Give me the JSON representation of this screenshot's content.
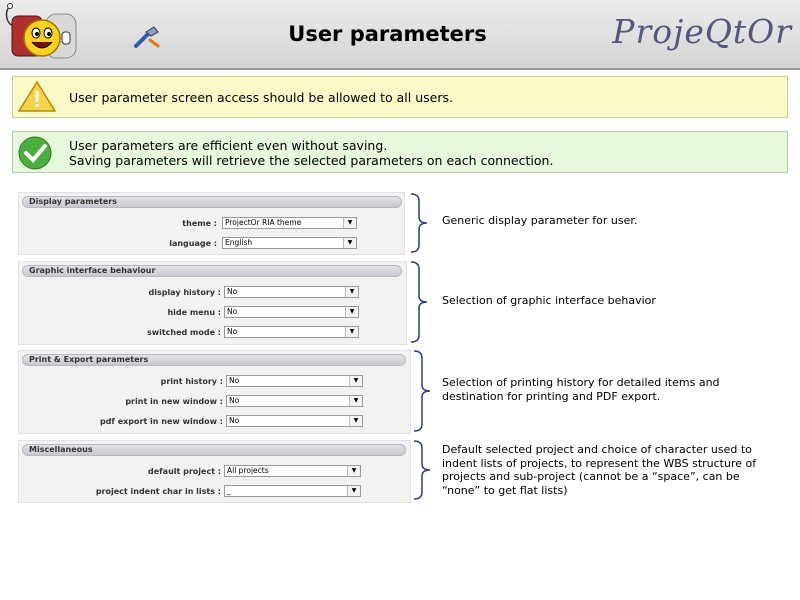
{
  "header": {
    "title": "User parameters",
    "brand": "ProjeQtOr",
    "icons": [
      "mascot-logo-icon",
      "tool-icon"
    ]
  },
  "notes": {
    "warning": "User parameter screen access should be allowed to all users.",
    "ok_line1": "User parameters are efficient even without saving.",
    "ok_line2": "Saving parameters will retrieve the selected parameters on each connection."
  },
  "panels": {
    "display": {
      "title": "Display parameters",
      "fields": [
        {
          "label": "theme :",
          "value": "ProjectOr RIA theme"
        },
        {
          "label": "language :",
          "value": "English"
        }
      ]
    },
    "graphic": {
      "title": "Graphic interface behaviour",
      "fields": [
        {
          "label": "display history :",
          "value": "No"
        },
        {
          "label": "hide menu :",
          "value": "No"
        },
        {
          "label": "switched mode :",
          "value": "No"
        }
      ]
    },
    "print": {
      "title": "Print & Export parameters",
      "fields": [
        {
          "label": "print history :",
          "value": "No"
        },
        {
          "label": "print in new window :",
          "value": "No"
        },
        {
          "label": "pdf export in new window :",
          "value": "No"
        }
      ]
    },
    "misc": {
      "title": "Miscellaneous",
      "fields": [
        {
          "label": "default project :",
          "value": "All projects"
        },
        {
          "label": "project indent char in lists :",
          "value": "_"
        }
      ]
    }
  },
  "descriptions": {
    "display": [
      "Generic display parameter for user."
    ],
    "graphic": [
      "Selection of graphic interface behavior"
    ],
    "print": [
      "Selection of printing history for detailed items and",
      "destination for printing and PDF export."
    ],
    "misc": [
      "Default selected project and choice of character used to",
      "indent lists of projects, to represent the WBS structure of",
      "projects and sub-project (cannot be a “space”, can be",
      "“none” to get flat lists)"
    ]
  },
  "colors": {
    "warning_bg": "#fafac8",
    "ok_bg": "#e6f9dc",
    "brand": "#54587c",
    "brace": "#2b3a8c"
  }
}
